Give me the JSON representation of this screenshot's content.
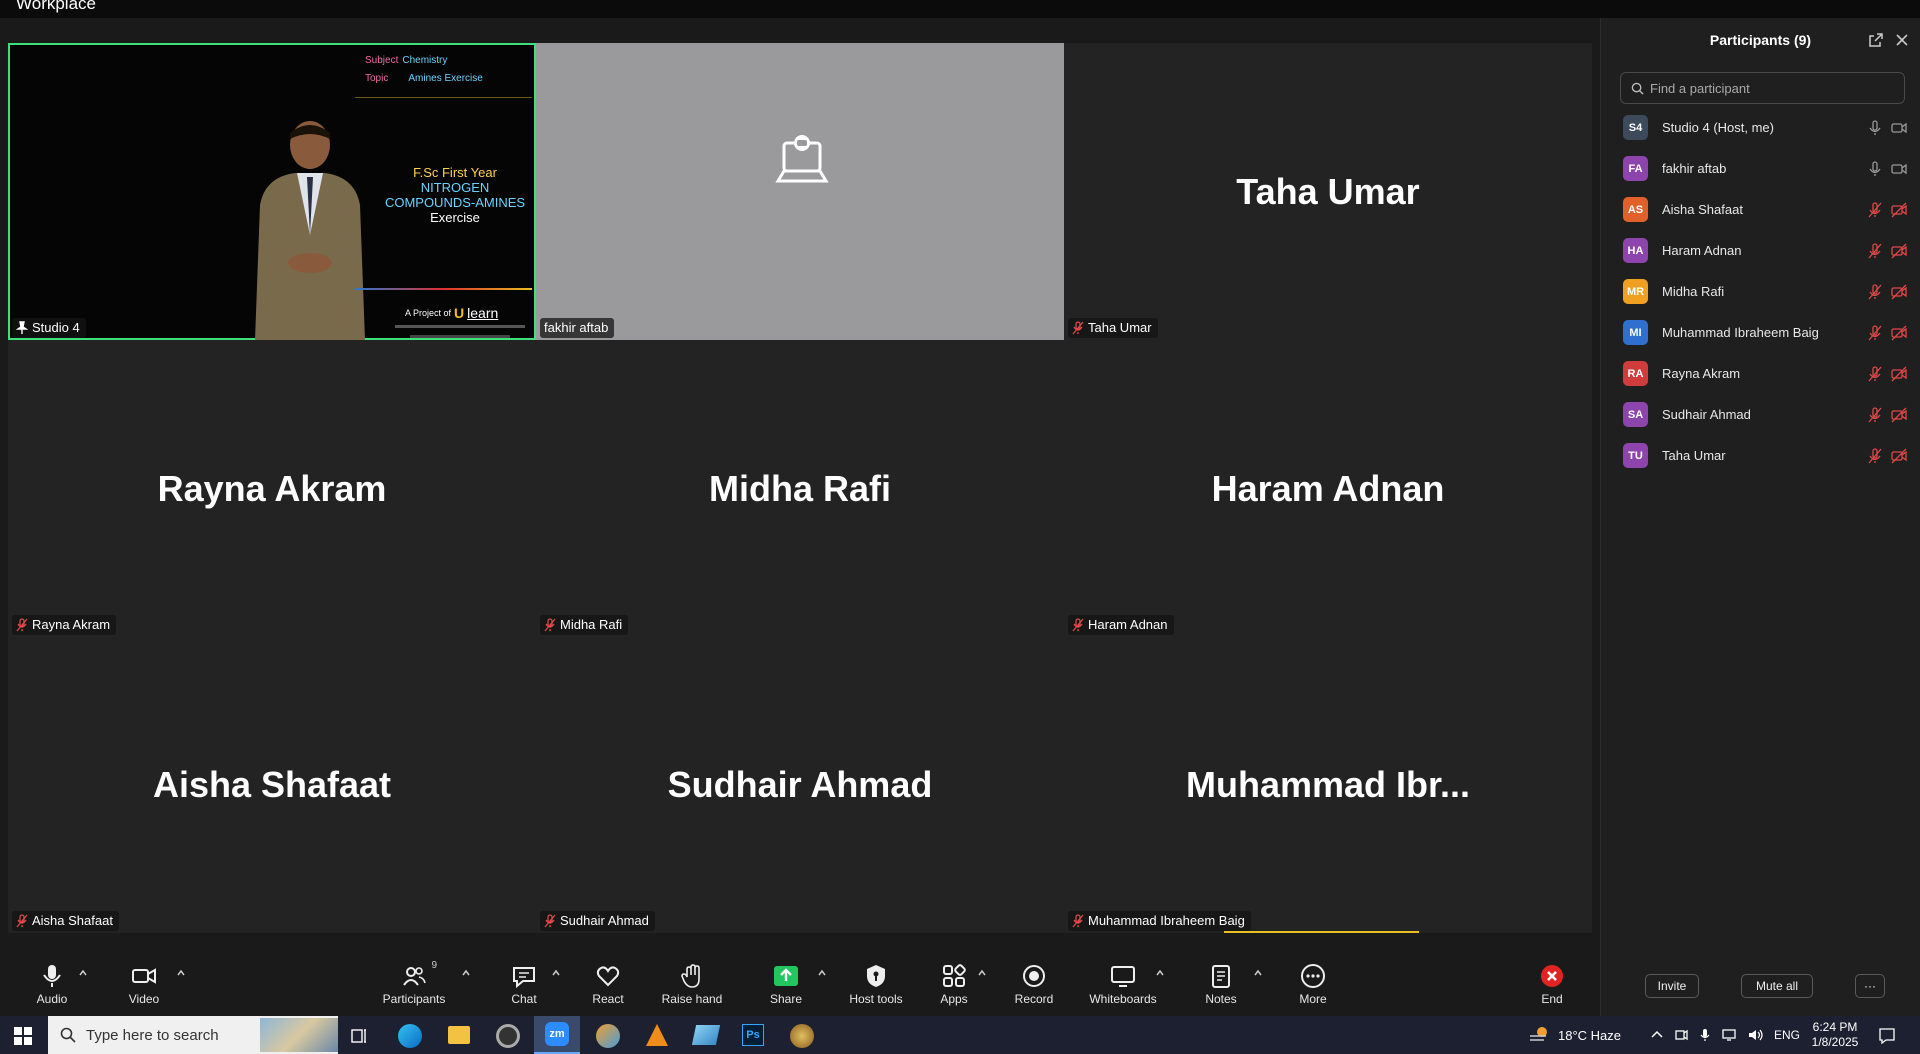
{
  "window": {
    "title": "Workplace"
  },
  "tiles": [
    {
      "id": "studio4",
      "label": "Studio 4",
      "type": "share",
      "mic": "pin"
    },
    {
      "id": "fakhir",
      "label": "fakhir aftab",
      "type": "camera-off",
      "mic": "none"
    },
    {
      "id": "taha",
      "big": "Taha Umar",
      "label": "Taha Umar",
      "mic": "muted"
    },
    {
      "id": "rayna",
      "big": "Rayna Akram",
      "label": "Rayna Akram",
      "mic": "muted"
    },
    {
      "id": "midha",
      "big": "Midha Rafi",
      "label": "Midha Rafi",
      "mic": "muted"
    },
    {
      "id": "haram",
      "big": "Haram Adnan",
      "label": "Haram Adnan",
      "mic": "muted"
    },
    {
      "id": "aisha",
      "big": "Aisha Shafaat",
      "label": "Aisha Shafaat",
      "mic": "muted"
    },
    {
      "id": "sudhair",
      "big": "Sudhair Ahmad",
      "label": "Sudhair Ahmad",
      "mic": "muted"
    },
    {
      "id": "muhammad",
      "big": "Muhammad  Ibr...",
      "label": "Muhammad Ibraheem Baig",
      "mic": "muted"
    }
  ],
  "slide": {
    "subject_label": "Subject",
    "subject_value": "Chemistry",
    "topic_label": "Topic",
    "topic_value": "Amines Exercise",
    "line1": "F.Sc First Year",
    "line2": "NITROGEN",
    "line3": "COMPOUNDS-AMINES",
    "line4": "Exercise",
    "project_prefix": "A Project of",
    "logo_u": "U",
    "logo_learn": "learn"
  },
  "panel": {
    "title": "Participants (9)",
    "search_placeholder": "Find a participant",
    "participants": [
      {
        "initials": "S4",
        "name": "Studio 4 (Host, me)",
        "color": "#3c4a5c",
        "muted": false
      },
      {
        "initials": "FA",
        "name": "fakhir aftab",
        "color": "#8e44ad",
        "muted": false
      },
      {
        "initials": "AS",
        "name": "Aisha Shafaat",
        "color": "#e0622a",
        "muted": true
      },
      {
        "initials": "HA",
        "name": "Haram Adnan",
        "color": "#8e44ad",
        "muted": true
      },
      {
        "initials": "MR",
        "name": "Midha Rafi",
        "color": "#f0a020",
        "muted": true
      },
      {
        "initials": "MI",
        "name": "Muhammad Ibraheem Baig",
        "color": "#2f6fd0",
        "muted": true
      },
      {
        "initials": "RA",
        "name": "Rayna Akram",
        "color": "#d03c3c",
        "muted": true
      },
      {
        "initials": "SA",
        "name": "Sudhair Ahmad",
        "color": "#8e44ad",
        "muted": true
      },
      {
        "initials": "TU",
        "name": "Taha Umar",
        "color": "#8e44ad",
        "muted": true
      }
    ],
    "invite_label": "Invite",
    "mute_all_label": "Mute all",
    "more_label": "···"
  },
  "toolbar": {
    "audio": "Audio",
    "video": "Video",
    "participants": "Participants",
    "participants_count": "9",
    "chat": "Chat",
    "react": "React",
    "raise_hand": "Raise hand",
    "share": "Share",
    "host_tools": "Host tools",
    "apps": "Apps",
    "record": "Record",
    "whiteboards": "Whiteboards",
    "notes": "Notes",
    "more": "More",
    "end": "End"
  },
  "taskbar": {
    "search_placeholder": "Type here to search",
    "weather": "18°C  Haze",
    "language": "ENG",
    "time": "6:24 PM",
    "date": "1/8/2025"
  },
  "colors": {
    "active_border": "#3ee07a",
    "muted_red": "#e04848",
    "share_green": "#22c55e",
    "end_red": "#e02424"
  }
}
